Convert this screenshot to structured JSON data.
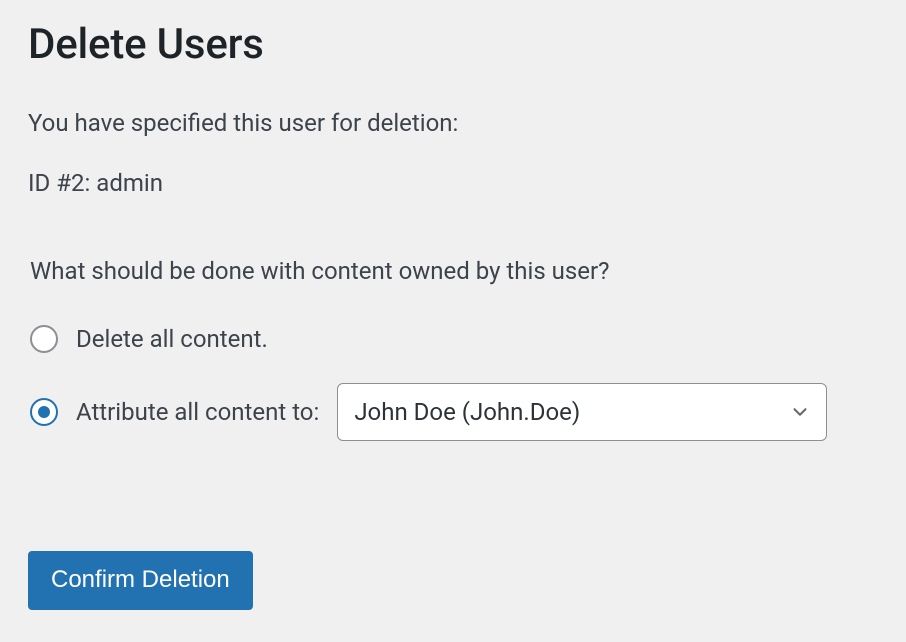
{
  "page_title": "Delete Users",
  "intro_text": "You have specified this user for deletion:",
  "user_line": "ID #2: admin",
  "content_question": "What should be done with content owned by this user?",
  "options": {
    "delete_all": {
      "label": "Delete all content.",
      "checked": false
    },
    "attribute": {
      "label": "Attribute all content to:",
      "checked": true,
      "select": {
        "value": "John Doe (John.Doe)"
      }
    }
  },
  "confirm_button_label": "Confirm Deletion",
  "colors": {
    "primary": "#2271b1",
    "text": "#3c434a",
    "heading": "#1d2327",
    "border": "#8c8f94",
    "bg": "#f0f0f1"
  }
}
